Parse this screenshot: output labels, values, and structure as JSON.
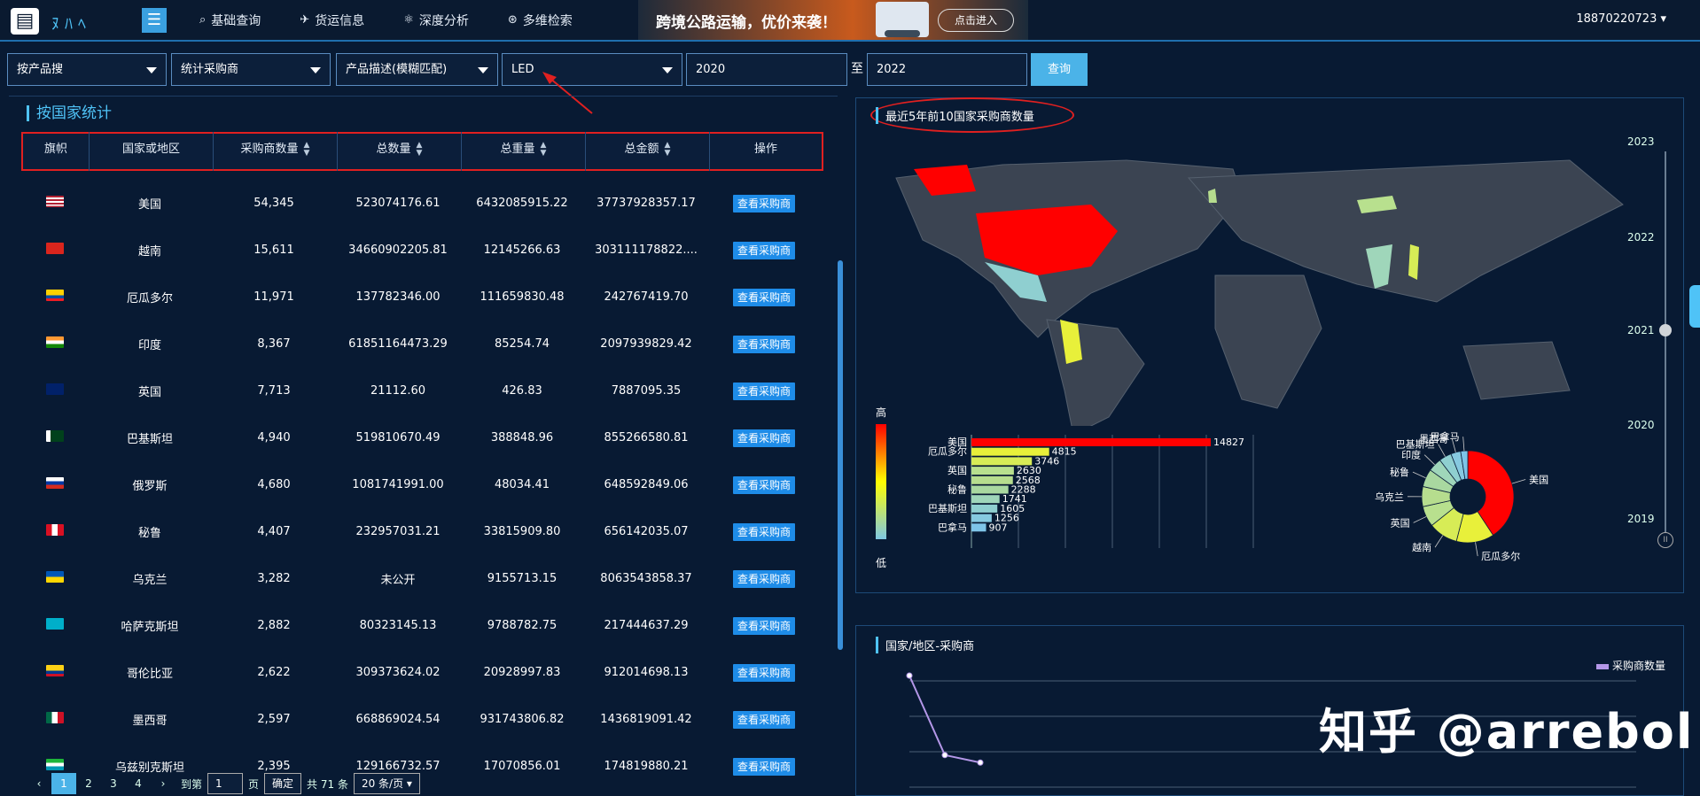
{
  "header": {
    "logo": "▤",
    "logo_text": "ﾇﾊﾍ",
    "menu_icon": "☰",
    "nav": [
      {
        "icon": "search-icon",
        "glyph": "⌕",
        "label": "基础查询"
      },
      {
        "icon": "plane-icon",
        "glyph": "✈",
        "label": "货运信息"
      },
      {
        "icon": "analysis-icon",
        "glyph": "⚛",
        "label": "深度分析"
      },
      {
        "icon": "multi-search-icon",
        "glyph": "⊛",
        "label": "多维检索"
      }
    ],
    "banner_text": "跨境公路运输，优价来袭！",
    "banner_button": "点击进入",
    "user": "18870220723 ▾"
  },
  "filters": {
    "search_mode": "按产品搜",
    "stat_mode": "统计采购商",
    "match_mode": "产品描述(模糊匹配)",
    "keyword": "LED",
    "year_from": "2020",
    "to_label": "至",
    "year_to": "2022",
    "query_button": "查询"
  },
  "country_table": {
    "title": "按国家统计",
    "headers": [
      "旗帜",
      "国家或地区",
      "采购商数量",
      "总数量",
      "总重量",
      "总金额",
      "操作"
    ],
    "button_label": "查看采购商",
    "rows": [
      {
        "flag": "us",
        "country": "美国",
        "buyers": "54,345",
        "qty": "523074176.61",
        "weight": "6432085915.22",
        "amount": "37737928357.17"
      },
      {
        "flag": "vn",
        "country": "越南",
        "buyers": "15,611",
        "qty": "34660902205.81",
        "weight": "12145266.63",
        "amount": "303111178822...."
      },
      {
        "flag": "ec",
        "country": "厄瓜多尔",
        "buyers": "11,971",
        "qty": "137782346.00",
        "weight": "111659830.48",
        "amount": "242767419.70"
      },
      {
        "flag": "in",
        "country": "印度",
        "buyers": "8,367",
        "qty": "61851164473.29",
        "weight": "85254.74",
        "amount": "2097939829.42"
      },
      {
        "flag": "gb",
        "country": "英国",
        "buyers": "7,713",
        "qty": "21112.60",
        "weight": "426.83",
        "amount": "7887095.35"
      },
      {
        "flag": "pk",
        "country": "巴基斯坦",
        "buyers": "4,940",
        "qty": "519810670.49",
        "weight": "388848.96",
        "amount": "855266580.81"
      },
      {
        "flag": "ru",
        "country": "俄罗斯",
        "buyers": "4,680",
        "qty": "1081741991.00",
        "weight": "48034.41",
        "amount": "648592849.06"
      },
      {
        "flag": "pe",
        "country": "秘鲁",
        "buyers": "4,407",
        "qty": "232957031.21",
        "weight": "33815909.80",
        "amount": "656142035.07"
      },
      {
        "flag": "ua",
        "country": "乌克兰",
        "buyers": "3,282",
        "qty": "未公开",
        "weight": "9155713.15",
        "amount": "8063543858.37"
      },
      {
        "flag": "kz",
        "country": "哈萨克斯坦",
        "buyers": "2,882",
        "qty": "80323145.13",
        "weight": "9788782.75",
        "amount": "217444637.29"
      },
      {
        "flag": "co",
        "country": "哥伦比亚",
        "buyers": "2,622",
        "qty": "309373624.02",
        "weight": "20928997.83",
        "amount": "912014698.13"
      },
      {
        "flag": "mx",
        "country": "墨西哥",
        "buyers": "2,597",
        "qty": "668869024.54",
        "weight": "931743806.82",
        "amount": "1436819091.42"
      },
      {
        "flag": "uz",
        "country": "乌兹别克斯坦",
        "buyers": "2,395",
        "qty": "129166732.57",
        "weight": "17070856.01",
        "amount": "174819880.21"
      }
    ],
    "pager": {
      "pages": [
        "1",
        "2",
        "3",
        "4"
      ],
      "goto_label": "到第",
      "goto_value": "1",
      "page_unit": "页",
      "confirm": "确定",
      "total": "共 71 条",
      "page_size": "20 条/页 ▾"
    }
  },
  "map_panel": {
    "title": "最近5年前10国家采购商数量",
    "legend_high": "高",
    "legend_low": "低",
    "years": [
      "2023",
      "2022",
      "2021",
      "2020",
      "2019"
    ],
    "current_year": "2021",
    "pause_icon": "II"
  },
  "chart_data": [
    {
      "type": "bar",
      "orientation": "horizontal",
      "categories": [
        "美国",
        "厄瓜多尔",
        "",
        "英国",
        "",
        "秘鲁",
        "",
        "巴基斯坦",
        "",
        "巴拿马"
      ],
      "values": [
        14827,
        4815,
        3746,
        2630,
        2568,
        2288,
        1741,
        1605,
        1256,
        907
      ],
      "colors": [
        "#ff0000",
        "#e8f03a",
        "#d7ec56",
        "#b8e08e",
        "#b6dd8e",
        "#a9d8a0",
        "#9fd6ba",
        "#8fcfd0",
        "#86c9e0",
        "#7ec4e8"
      ]
    },
    {
      "type": "pie",
      "donut": true,
      "labels": [
        "美国",
        "厄瓜多尔",
        "越南",
        "英国",
        "乌克兰",
        "秘鲁",
        "印度",
        "巴基斯坦",
        "墨西哥",
        "巴拿马"
      ],
      "values": [
        14827,
        4815,
        3746,
        2630,
        2568,
        2288,
        1741,
        1605,
        1256,
        907
      ],
      "colors": [
        "#ff0000",
        "#e8f03a",
        "#d7ec56",
        "#b8e08e",
        "#b6dd8e",
        "#a9d8a0",
        "#9fd6ba",
        "#8fcfd0",
        "#86c9e0",
        "#7ec4e8"
      ]
    },
    {
      "type": "line",
      "title": "国家/地区-采购商",
      "series": [
        {
          "name": "采购商数量",
          "values": [
            54345,
            15611,
            11971
          ]
        }
      ],
      "color": "#b497e8"
    }
  ],
  "watermark": "知乎 @arrebol"
}
